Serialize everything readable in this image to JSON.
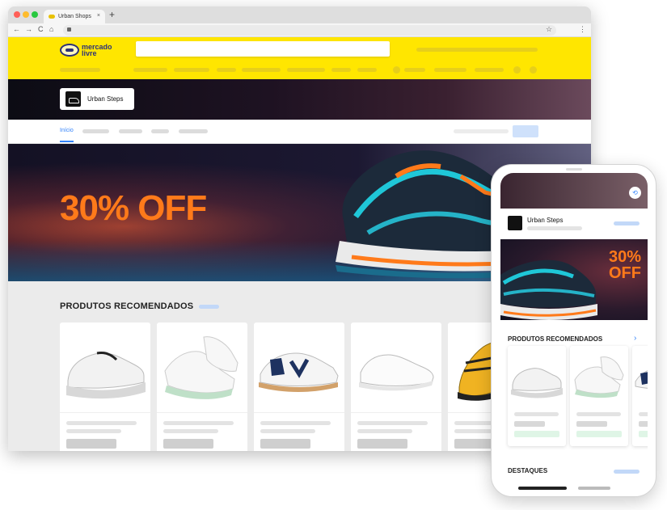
{
  "browser": {
    "tab_title": "Urban Shops",
    "tab_close": "×",
    "new_tab": "+",
    "nav_back": "←",
    "nav_forward": "→",
    "nav_reload": "C",
    "nav_home": "⌂",
    "bookmark": "☆",
    "menu": "⋮"
  },
  "header": {
    "logo_text": "mercado livre"
  },
  "store": {
    "name": "Urban Steps",
    "nav_active": "Início"
  },
  "hero": {
    "headline": "30% OFF"
  },
  "recommended": {
    "title": "PRODUTOS RECOMENDADOS",
    "product_icons": [
      "white-running-shoe-icon",
      "white-green-sneaker-icon",
      "white-navy-sneaker-icon",
      "white-court-shoe-icon",
      "yellow-sneaker-icon"
    ]
  },
  "mobile": {
    "store_name": "Urban Steps",
    "hero_line1": "30%",
    "hero_line2": "OFF",
    "recommended_title": "PRODUTOS RECOMENDADOS",
    "recommended_arrow": "›",
    "highlights_title": "DESTAQUES",
    "share_icon": "share-icon"
  },
  "colors": {
    "brand_yellow": "#ffe600",
    "accent_orange": "#ff7a1a",
    "link_blue": "#3483fa"
  }
}
